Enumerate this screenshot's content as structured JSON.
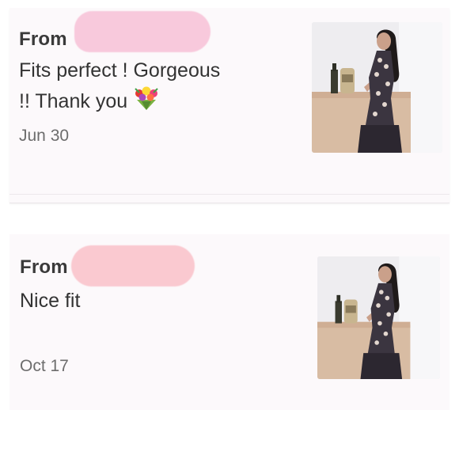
{
  "reviews": [
    {
      "from_label": "From",
      "text_line1": "Fits perfect ! Gorgeous",
      "text_line2": "!! Thank you",
      "emoji_icon": "bouquet-icon",
      "date": "Jun 30",
      "redaction_color": "#f8c9dc"
    },
    {
      "from_label": "From",
      "text_line1": "Nice fit",
      "date": "Oct 17",
      "redaction_color": "#fac9d0"
    }
  ],
  "colors": {
    "card_background": "#fcf9fb",
    "text": "#333333",
    "date": "#6d6d6d"
  }
}
